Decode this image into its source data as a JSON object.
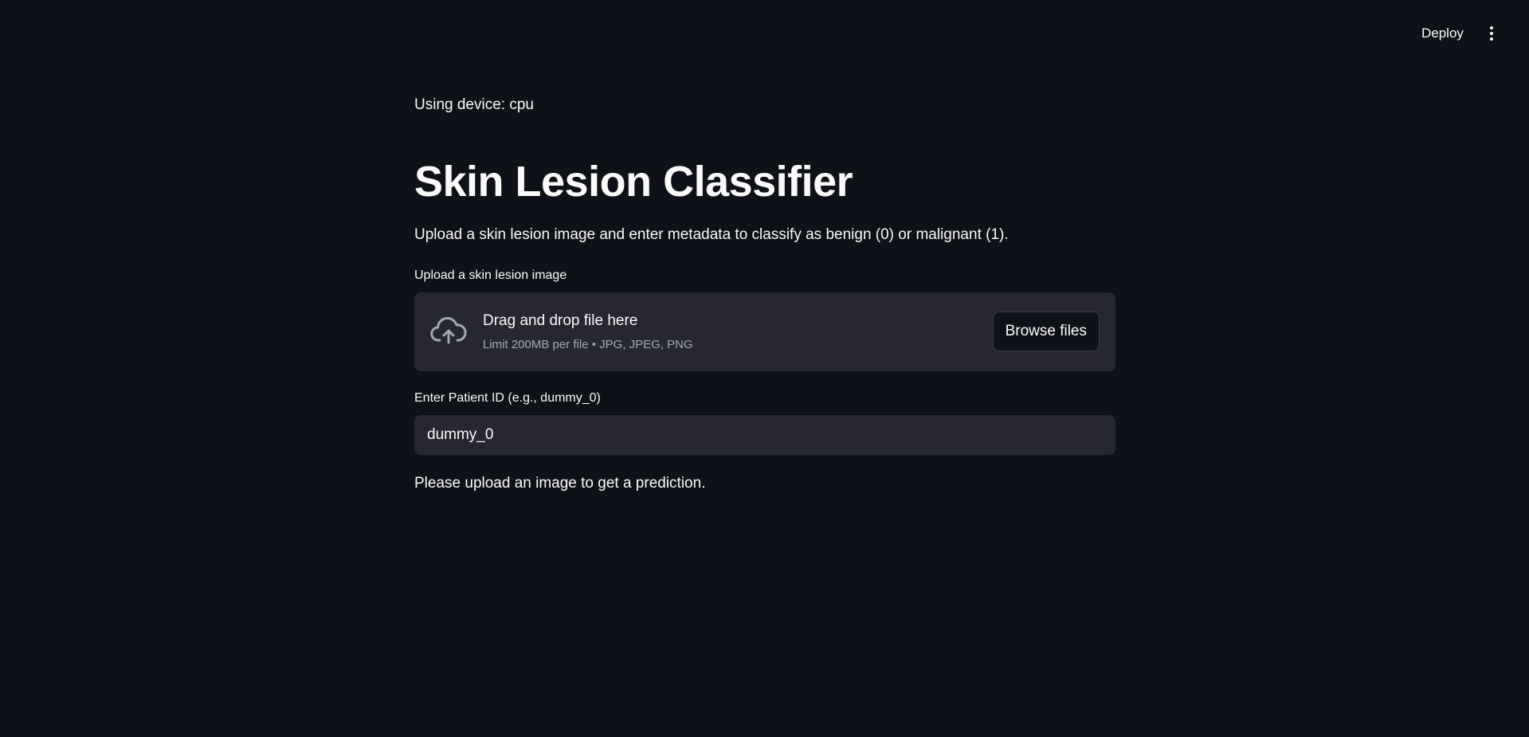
{
  "header": {
    "deploy_label": "Deploy",
    "menu_icon": "kebab-menu-icon"
  },
  "main": {
    "device_text": "Using device: cpu",
    "title": "Skin Lesion Classifier",
    "description": "Upload a skin lesion image and enter metadata to classify as benign (0) or malignant (1).",
    "uploader": {
      "label": "Upload a skin lesion image",
      "icon": "cloud-upload-icon",
      "drop_text": "Drag and drop file here",
      "limit_text": "Limit 200MB per file • JPG, JPEG, PNG",
      "browse_label": "Browse files"
    },
    "patient": {
      "label": "Enter Patient ID (e.g., dummy_0)",
      "value": "dummy_0"
    },
    "info_text": "Please upload an image to get a prediction."
  },
  "colors": {
    "background": "#0e1117",
    "surface": "#262730",
    "text": "#fafafa",
    "muted_text": "#a3a8b8"
  }
}
